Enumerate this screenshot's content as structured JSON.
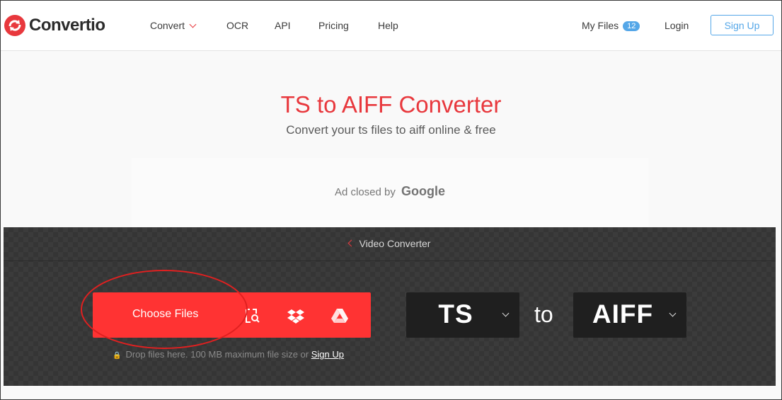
{
  "brand": {
    "name": "Convertio",
    "accent": "#e8383d",
    "link_color": "#55a7e8"
  },
  "nav": {
    "convert_label": "Convert",
    "ocr_label": "OCR",
    "api_label": "API",
    "pricing_label": "Pricing",
    "help_label": "Help",
    "my_files_label": "My Files",
    "my_files_count": "12",
    "login_label": "Login",
    "signup_label": "Sign Up"
  },
  "hero": {
    "title": "TS to AIFF Converter",
    "subtitle": "Convert your ts files to aiff online & free"
  },
  "ad": {
    "text": "Ad closed by",
    "brand": "Google"
  },
  "converter": {
    "breadcrumb": "Video Converter",
    "choose_files_label": "Choose Files",
    "source_icons": [
      "file-search-icon",
      "dropbox-icon",
      "google-drive-icon"
    ],
    "drop_note": "Drop files here. 100 MB maximum file size or",
    "drop_signup": "Sign Up",
    "from_format": "TS",
    "to_word": "to",
    "to_format": "AIFF"
  }
}
